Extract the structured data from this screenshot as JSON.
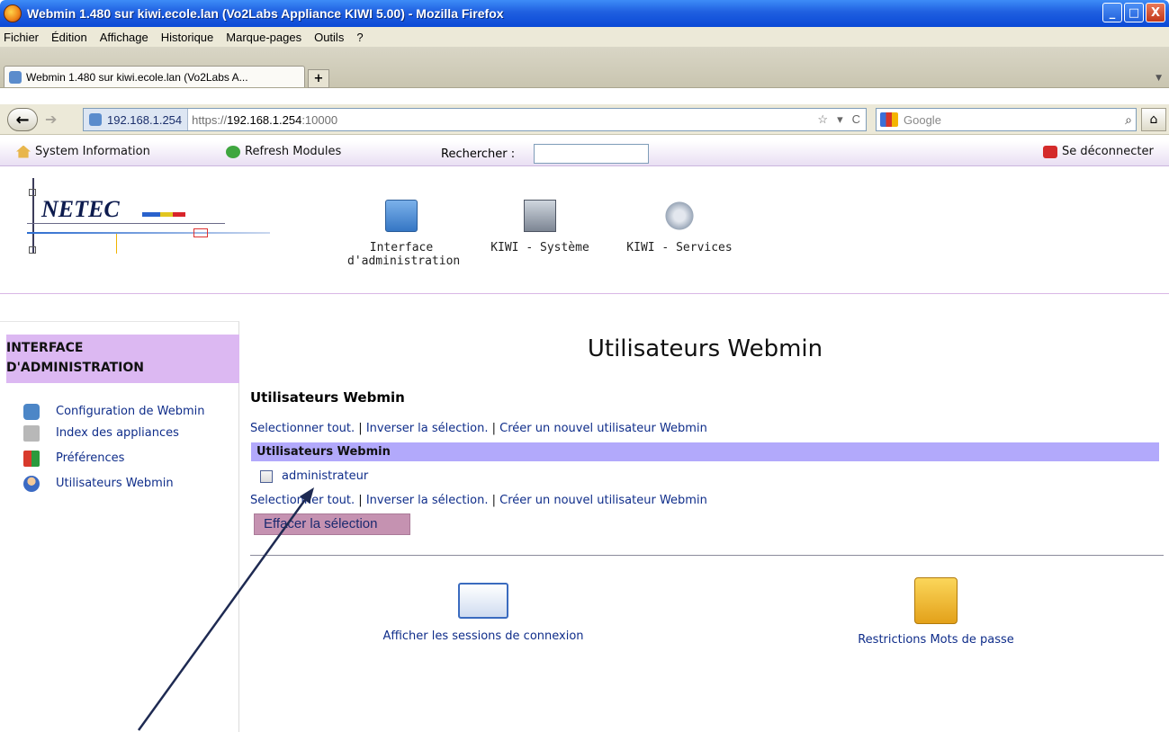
{
  "window": {
    "title": "Webmin 1.480 sur kiwi.ecole.lan (Vo2Labs Appliance KIWI 5.00) - Mozilla Firefox"
  },
  "menu": [
    "Fichier",
    "Édition",
    "Affichage",
    "Historique",
    "Marque-pages",
    "Outils",
    "?"
  ],
  "tab": {
    "label": "Webmin 1.480 sur kiwi.ecole.lan (Vo2Labs A...",
    "new_tab_label": "+"
  },
  "nav": {
    "site_label": "192.168.1.254",
    "url_prefix": "https://",
    "url_host": "192.168.1.254",
    "url_port": ":10000",
    "search_placeholder": "Google"
  },
  "webmin_bar": {
    "system_info": "System Information",
    "refresh_modules": "Refresh Modules",
    "search_label": "Rechercher :",
    "logout": "Se déconnecter"
  },
  "header": {
    "logo_text": "NETEC",
    "modules": [
      {
        "label_line1": "Interface",
        "label_line2": "d'administration",
        "icon": "admin-interface-icon"
      },
      {
        "label_line1": "KIWI - Système",
        "label_line2": "",
        "icon": "computer-icon"
      },
      {
        "label_line1": "KIWI - Services",
        "label_line2": "",
        "icon": "gears-icon"
      }
    ]
  },
  "sidebar": {
    "heading_line1": "INTERFACE",
    "heading_line2": "D'ADMINISTRATION",
    "items": [
      {
        "label": "Configuration de Webmin",
        "icon": "webmin-config-icon"
      },
      {
        "label": "Index des appliances",
        "icon": "appliance-index-icon"
      },
      {
        "label": "Préférences",
        "icon": "preferences-icon"
      },
      {
        "label": "Utilisateurs Webmin",
        "icon": "users-icon"
      }
    ]
  },
  "main": {
    "page_title": "Utilisateurs Webmin",
    "section_title": "Utilisateurs Webmin",
    "select_all": "Selectionner tout.",
    "invert_selection": "Inverser la sélection.",
    "create_user": "Créer un nouvel utilisateur Webmin",
    "separator": "|",
    "table_header": "Utilisateurs Webmin",
    "users": [
      {
        "name": "administrateur",
        "checked": false
      }
    ],
    "delete_button": "Effacer la sélection",
    "bottom_items": [
      {
        "label": "Afficher les sessions de connexion",
        "icon": "sessions-icon"
      },
      {
        "label": "Restrictions Mots de passe",
        "icon": "padlock-icon"
      }
    ]
  },
  "colors": {
    "titlebar": "#0a49d6",
    "sidebar_heading_bg": "#dcb8f2",
    "table_header_bg": "#b2a9fb",
    "delete_button_bg": "#c592b1",
    "link": "#0f2d8a"
  }
}
